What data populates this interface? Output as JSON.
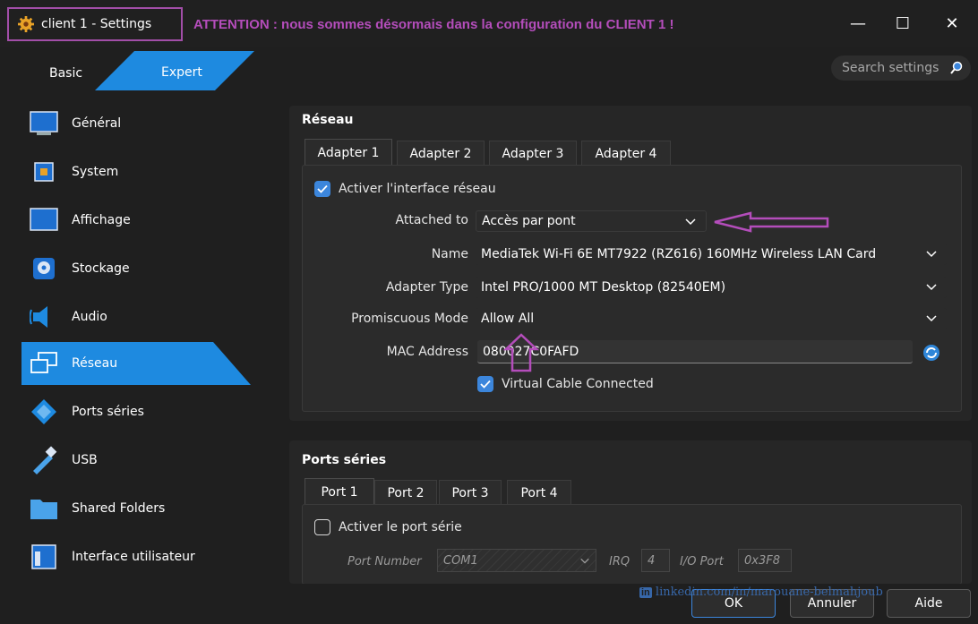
{
  "window": {
    "title": "client 1 - Settings",
    "attention_note": "ATTENTION : nous sommes désormais dans la configuration du CLIENT 1 !",
    "controls": {
      "minimize": "—",
      "maximize": "☐",
      "close": "✕"
    }
  },
  "mode_tabs": {
    "basic": "Basic",
    "expert": "Expert",
    "active": "Expert"
  },
  "search": {
    "placeholder": "Search settings"
  },
  "sidebar": {
    "items": [
      {
        "label": "Général",
        "icon": "monitor-icon"
      },
      {
        "label": "System",
        "icon": "chip-icon"
      },
      {
        "label": "Affichage",
        "icon": "display-icon"
      },
      {
        "label": "Stockage",
        "icon": "disk-icon"
      },
      {
        "label": "Audio",
        "icon": "speaker-icon"
      },
      {
        "label": "Réseau",
        "icon": "network-icon",
        "active": true
      },
      {
        "label": "Ports séries",
        "icon": "serial-port-icon"
      },
      {
        "label": "USB",
        "icon": "usb-icon"
      },
      {
        "label": "Shared Folders",
        "icon": "folder-icon"
      },
      {
        "label": "Interface utilisateur",
        "icon": "ui-window-icon"
      }
    ]
  },
  "network": {
    "section_title": "Réseau",
    "tabs": [
      "Adapter 1",
      "Adapter 2",
      "Adapter 3",
      "Adapter 4"
    ],
    "active_tab": "Adapter 1",
    "enable_label": "Activer l'interface réseau",
    "enable_checked": true,
    "attached_to": {
      "label": "Attached to",
      "value": "Accès par pont"
    },
    "name": {
      "label": "Name",
      "value": "MediaTek Wi-Fi 6E MT7922 (RZ616) 160MHz Wireless LAN Card"
    },
    "adapter_type": {
      "label": "Adapter Type",
      "value": "Intel PRO/1000 MT Desktop (82540EM)"
    },
    "promiscuous": {
      "label": "Promiscuous Mode",
      "value": "Allow All"
    },
    "mac": {
      "label": "MAC Address",
      "value": "080027C0FAFD"
    },
    "cable_label": "Virtual Cable Connected",
    "cable_checked": true
  },
  "serial": {
    "section_title": "Ports séries",
    "tabs": [
      "Port 1",
      "Port 2",
      "Port 3",
      "Port 4"
    ],
    "active_tab": "Port 1",
    "enable_label": "Activer le port série",
    "enable_checked": false,
    "port_number": {
      "label": "Port Number",
      "value": "COM1"
    },
    "irq": {
      "label": "IRQ",
      "value": "4"
    },
    "io_port": {
      "label": "I/O Port",
      "value": "0x3F8"
    }
  },
  "watermark": "linkedin.com/in/marouane-belmahjoub",
  "buttons": {
    "ok": "OK",
    "cancel": "Annuler",
    "help": "Aide"
  },
  "colors": {
    "accent": "#1e8ae0",
    "annotation": "#b44dbb",
    "checkbox": "#3c86dc"
  }
}
